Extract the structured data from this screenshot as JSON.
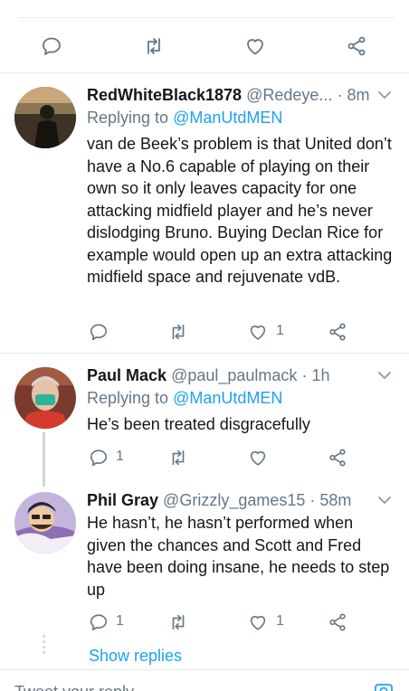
{
  "top_actions": [
    "reply-icon",
    "retweet-icon",
    "like-icon",
    "share-icon"
  ],
  "tweets": [
    {
      "name": "RedWhiteBlack1878",
      "handle": "@Redeye...",
      "dot": "·",
      "time": "8m",
      "replying_label": "Replying to",
      "replying_to": "@ManUtdMEN",
      "text": "van de Beek’s problem is that United don’t have a No.6 capable of playing on their own so it only leaves capacity for one attacking midfield player and he’s never dislodging Bruno. Buying Declan Rice for example would open up an extra attacking midfield space and rejuvenate vdB.",
      "reply_count": "",
      "retweet_count": "",
      "like_count": "1"
    },
    {
      "name": "Paul Mack",
      "handle": "@paul_paulmack",
      "dot": "·",
      "time": "1h",
      "replying_label": "Replying to",
      "replying_to": "@ManUtdMEN",
      "text": "He’s been treated disgracefully",
      "reply_count": "1",
      "retweet_count": "",
      "like_count": ""
    },
    {
      "name": "Phil Gray",
      "handle": "@Grizzly_games15",
      "dot": "·",
      "time": "58m",
      "text": "He hasn’t, he hasn’t performed when given the chances and Scott and Fred have been doing insane, he needs to step up",
      "reply_count": "1",
      "retweet_count": "",
      "like_count": "1"
    }
  ],
  "show_replies": "Show replies",
  "compose_placeholder": "Tweet your reply",
  "colors": {
    "accent": "#1da1f2",
    "muted": "#657786",
    "text": "#14171a",
    "divider": "#e6ecf0"
  }
}
